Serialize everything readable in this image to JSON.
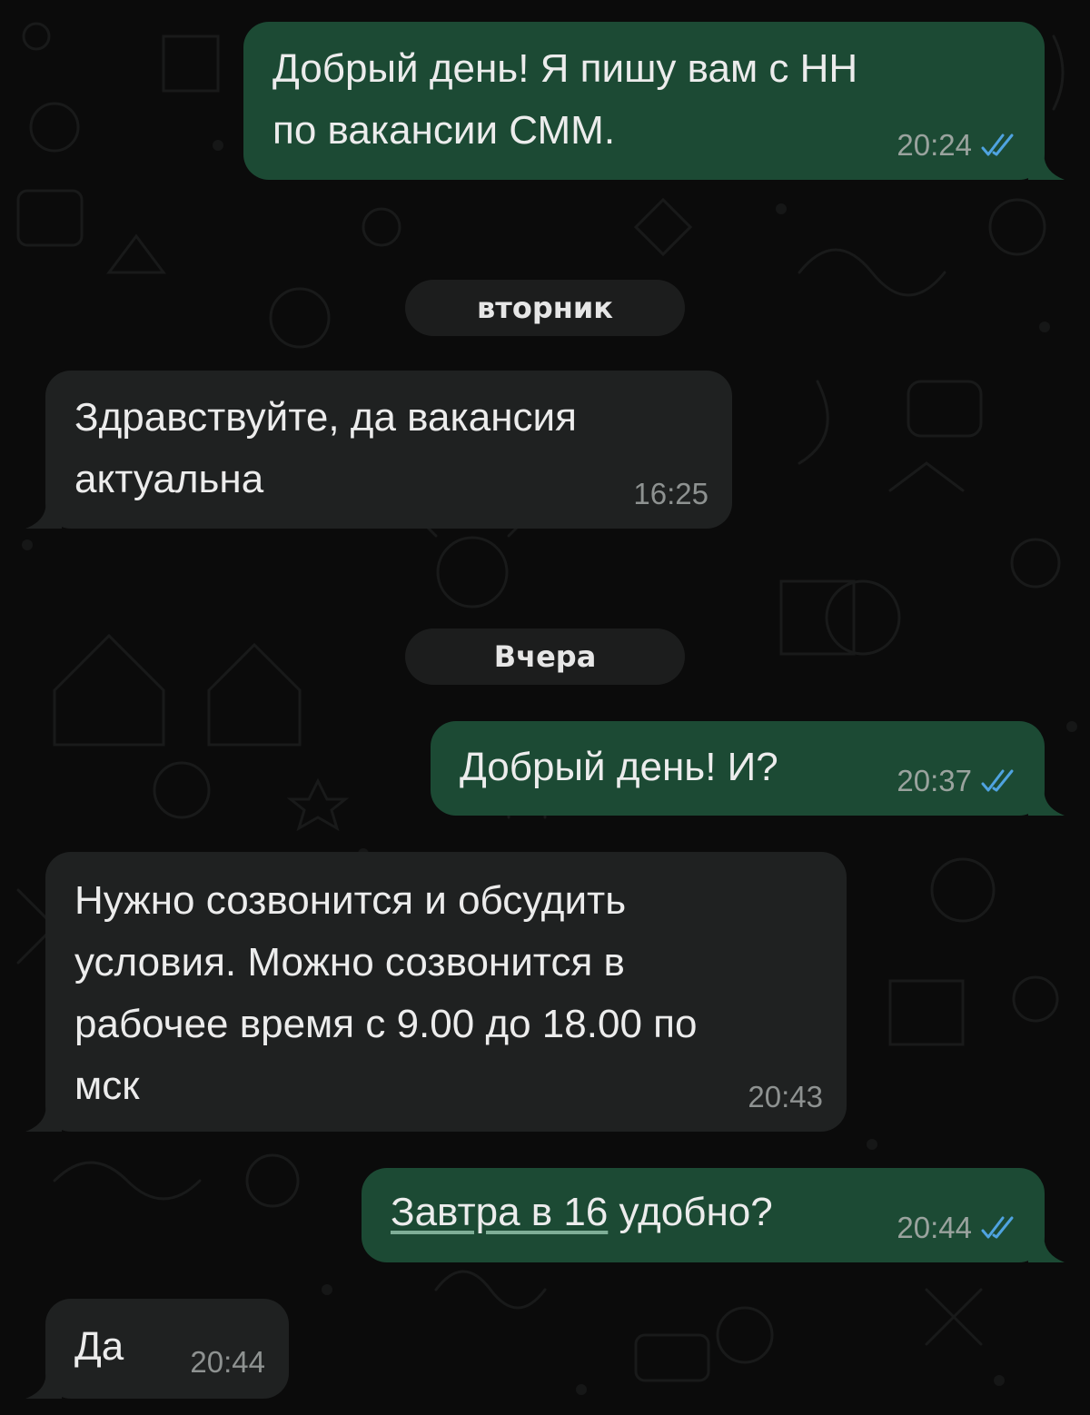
{
  "chat": {
    "date_separators": [
      {
        "label": "вторник"
      },
      {
        "label": "Вчера"
      }
    ],
    "messages": [
      {
        "direction": "outgoing",
        "text": "Добрый день! Я пишу вам с НН\nпо вакансии СММ.",
        "time": "20:24",
        "status": "read"
      },
      {
        "direction": "incoming",
        "text": "Здравствуйте, да вакансия\nактуальна",
        "time": "16:25"
      },
      {
        "direction": "outgoing",
        "text": "Добрый день! И?",
        "time": "20:37",
        "status": "read"
      },
      {
        "direction": "incoming",
        "text": "Нужно созвонится и обсудить\nусловия. Можно созвонится в\nрабочее время с 9.00 до 18.00 по\nмск",
        "time": "20:43"
      },
      {
        "direction": "outgoing",
        "link_text": "Завтра в 16",
        "text_after_link": " удобно?",
        "time": "20:44",
        "status": "read"
      },
      {
        "direction": "incoming",
        "text": "Да",
        "time": "20:44"
      }
    ]
  },
  "colors": {
    "background": "#0b0b0b",
    "outgoing_bubble": "#1c4a34",
    "incoming_bubble": "#1f2121",
    "read_check": "#4fa3e0",
    "timestamp": "#9aa39e"
  }
}
